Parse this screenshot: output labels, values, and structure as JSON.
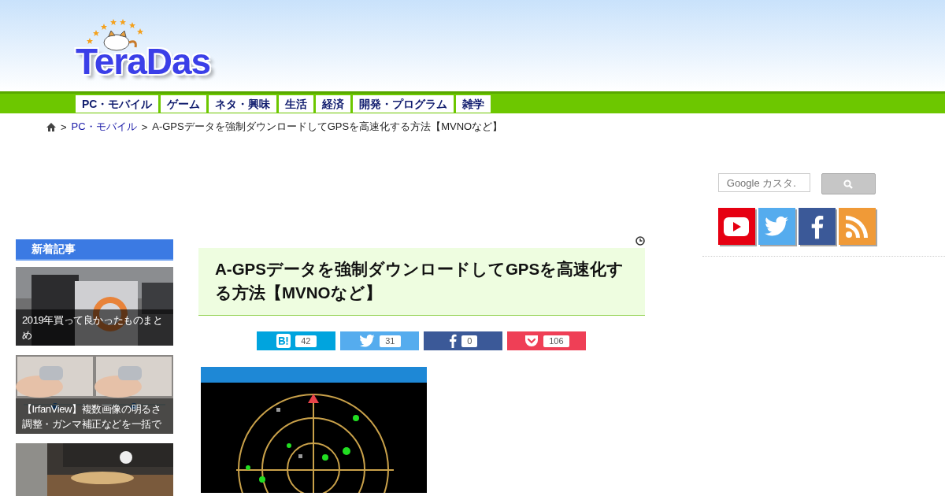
{
  "logo": {
    "text": "TeraDas"
  },
  "nav": [
    {
      "label": "PC・モバイル"
    },
    {
      "label": "ゲーム"
    },
    {
      "label": "ネタ・興味"
    },
    {
      "label": "生活"
    },
    {
      "label": "経済"
    },
    {
      "label": "開発・プログラム"
    },
    {
      "label": "雑学"
    }
  ],
  "breadcrumb": {
    "separator": ">",
    "items": [
      {
        "label": "PC・モバイル",
        "kind": "link"
      },
      {
        "label": "A-GPSデータを強制ダウンロードしてGPSを高速化する方法【MVNOなど】",
        "kind": "current"
      }
    ]
  },
  "search": {
    "placeholder": "Google カスタ."
  },
  "social": [
    {
      "kind": "youtube"
    },
    {
      "kind": "twitter"
    },
    {
      "kind": "facebook"
    },
    {
      "kind": "rss"
    }
  ],
  "sidebar": {
    "title": "新着記事",
    "articles": [
      {
        "caption": "2019年買って良かったものまとめ",
        "kind": "picture"
      },
      {
        "caption": "【IrfanView】複数画像の明るさ調整・ガンマ補正などを一括で",
        "kind": "picture"
      },
      {
        "kind": "picture"
      }
    ]
  },
  "article": {
    "title": "A-GPSデータを強制ダウンロードしてGPSを高速化する方法【MVNOなど】",
    "shares": [
      {
        "kind": "hatena",
        "count": "42"
      },
      {
        "kind": "twitter",
        "count": "31"
      },
      {
        "kind": "facebook",
        "count": "0"
      },
      {
        "kind": "pocket",
        "count": "106"
      }
    ],
    "image": {
      "kind": "picture"
    }
  }
}
